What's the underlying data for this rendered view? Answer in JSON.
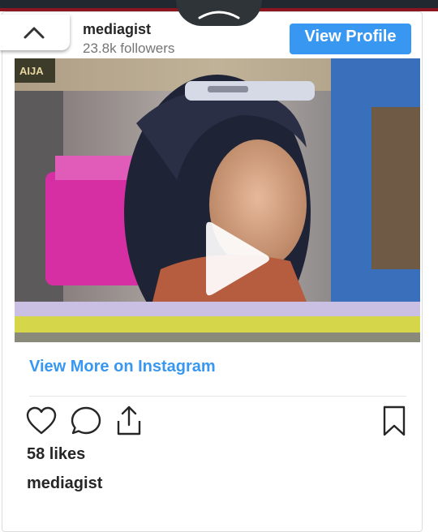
{
  "header": {
    "username": "mediagist",
    "followers": "23.8k followers",
    "view_profile_label": "View Profile"
  },
  "post": {
    "view_more_label": "View More on Instagram",
    "likes": "58 likes",
    "author": "mediagist"
  },
  "icons": {
    "collapse": "chevron-up-icon",
    "tab": "chevron-up-icon",
    "like": "heart-icon",
    "comment": "comment-icon",
    "share": "share-icon",
    "save": "bookmark-icon",
    "play": "play-icon"
  },
  "colors": {
    "accent": "#3897f0",
    "text": "#262626",
    "muted": "#757575"
  }
}
